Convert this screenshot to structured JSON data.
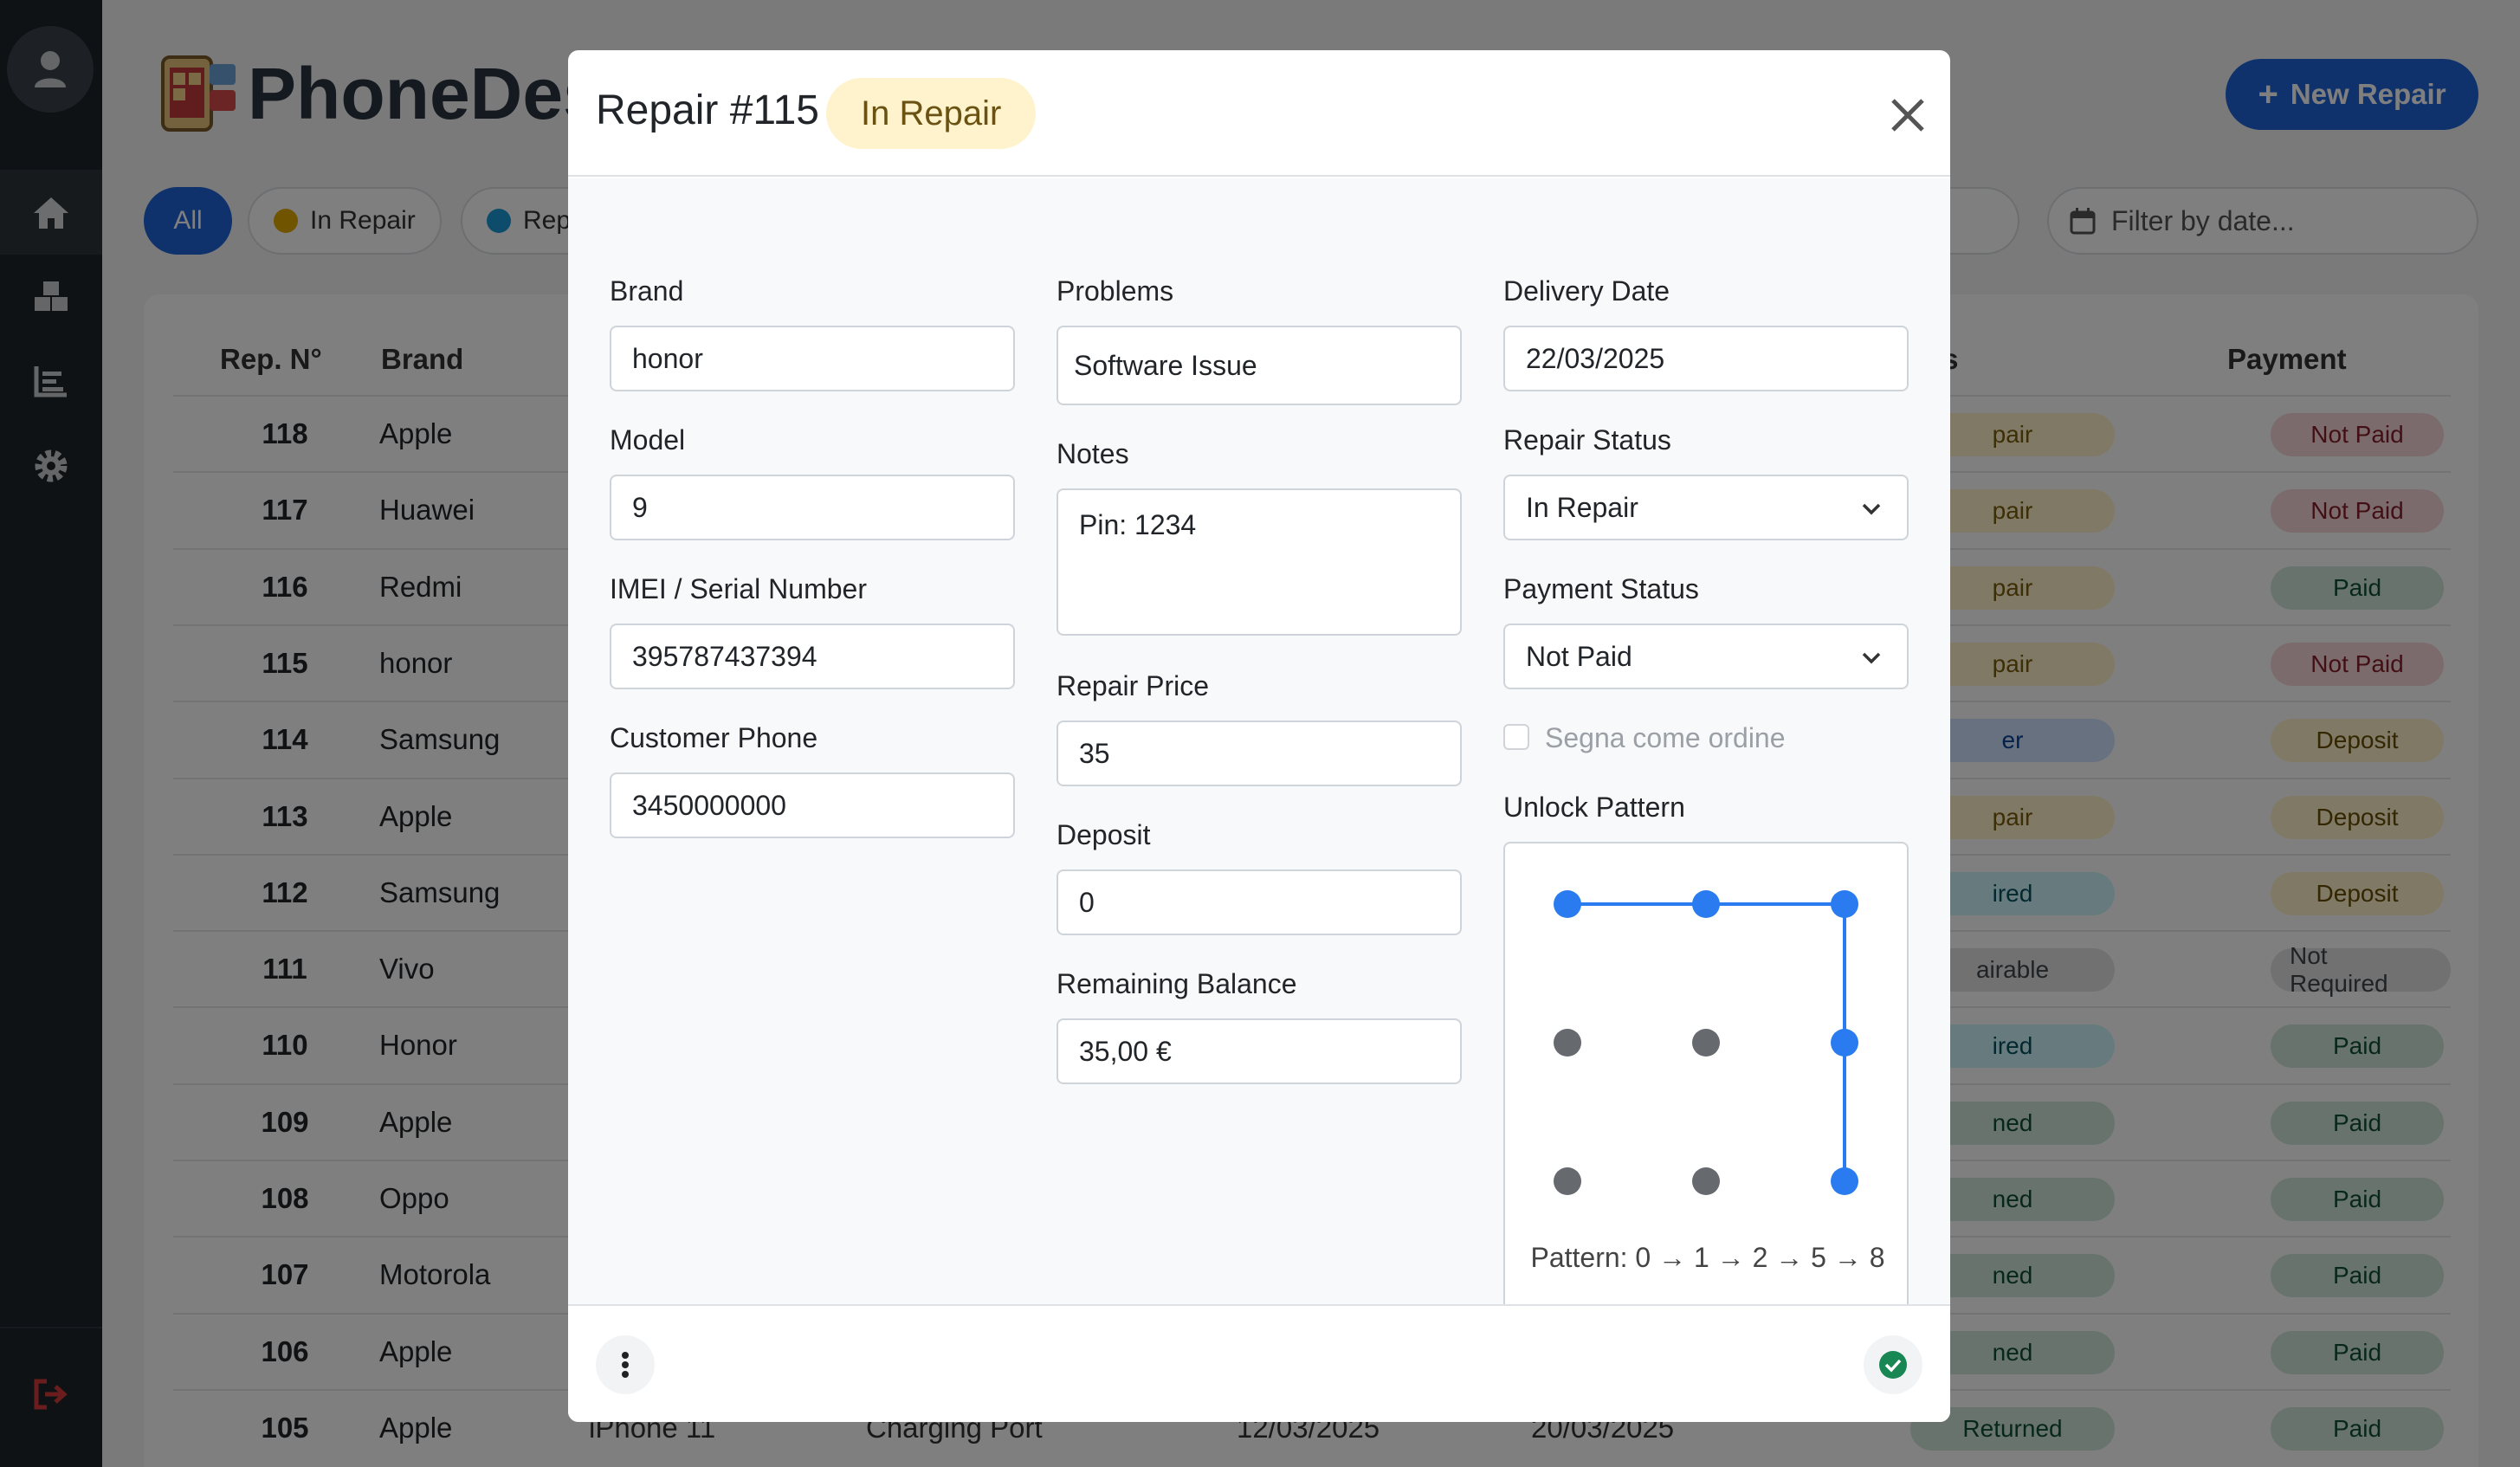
{
  "app": {
    "title": "PhoneDesk",
    "new_repair_label": "New Repair",
    "filter_placeholder": "Filter by date..."
  },
  "filters": {
    "all": "All",
    "in_repair": "In Repair",
    "repaired": "Rep"
  },
  "table": {
    "headers": {
      "num": "Rep. N°",
      "brand": "Brand",
      "status": "tus",
      "payment": "Payment"
    },
    "rows": [
      {
        "num": "118",
        "brand": "Apple",
        "status": "pair",
        "status_color": "#fff3cd",
        "status_text_color": "#7a5c0a",
        "payment": "Not Paid",
        "pay_bg": "#f8d7da",
        "pay_fg": "#842029"
      },
      {
        "num": "117",
        "brand": "Huawei",
        "status": "pair",
        "status_color": "#fff3cd",
        "status_text_color": "#7a5c0a",
        "payment": "Not Paid",
        "pay_bg": "#f8d7da",
        "pay_fg": "#842029"
      },
      {
        "num": "116",
        "brand": "Redmi",
        "status": "pair",
        "status_color": "#fff3cd",
        "status_text_color": "#7a5c0a",
        "payment": "Paid",
        "pay_bg": "#d1e7dd",
        "pay_fg": "#0f5132"
      },
      {
        "num": "115",
        "brand": "honor",
        "status": "pair",
        "status_color": "#fff3cd",
        "status_text_color": "#7a5c0a",
        "payment": "Not Paid",
        "pay_bg": "#f8d7da",
        "pay_fg": "#842029"
      },
      {
        "num": "114",
        "brand": "Samsung",
        "status": "er",
        "status_color": "#cfe2ff",
        "status_text_color": "#084298",
        "payment": "Deposit",
        "pay_bg": "#fff3cd",
        "pay_fg": "#664d03"
      },
      {
        "num": "113",
        "brand": "Apple",
        "status": "pair",
        "status_color": "#fff3cd",
        "status_text_color": "#7a5c0a",
        "payment": "Deposit",
        "pay_bg": "#fff3cd",
        "pay_fg": "#664d03"
      },
      {
        "num": "112",
        "brand": "Samsung",
        "status": "ired",
        "status_color": "#cff4fc",
        "status_text_color": "#055160",
        "payment": "Deposit",
        "pay_bg": "#fff3cd",
        "pay_fg": "#664d03"
      },
      {
        "num": "111",
        "brand": "Vivo",
        "status": "airable",
        "status_color": "#e2e3e5",
        "status_text_color": "#41464b",
        "payment": "Not Required",
        "pay_bg": "#e2e3e5",
        "pay_fg": "#41464b"
      },
      {
        "num": "110",
        "brand": "Honor",
        "status": "ired",
        "status_color": "#cff4fc",
        "status_text_color": "#055160",
        "payment": "Paid",
        "pay_bg": "#d1e7dd",
        "pay_fg": "#0f5132"
      },
      {
        "num": "109",
        "brand": "Apple",
        "status": "ned",
        "status_color": "#d1e7dd",
        "status_text_color": "#0f5132",
        "payment": "Paid",
        "pay_bg": "#d1e7dd",
        "pay_fg": "#0f5132"
      },
      {
        "num": "108",
        "brand": "Oppo",
        "status": "ned",
        "status_color": "#d1e7dd",
        "status_text_color": "#0f5132",
        "payment": "Paid",
        "pay_bg": "#d1e7dd",
        "pay_fg": "#0f5132"
      },
      {
        "num": "107",
        "brand": "Motorola",
        "status": "ned",
        "status_color": "#d1e7dd",
        "status_text_color": "#0f5132",
        "payment": "Paid",
        "pay_bg": "#d1e7dd",
        "pay_fg": "#0f5132"
      },
      {
        "num": "106",
        "brand": "Apple",
        "status": "ned",
        "status_color": "#d1e7dd",
        "status_text_color": "#0f5132",
        "payment": "Paid",
        "pay_bg": "#d1e7dd",
        "pay_fg": "#0f5132"
      },
      {
        "num": "105",
        "brand": "Apple",
        "model": "iPhone 11",
        "problem": "Charging Port",
        "date1": "12/03/2025",
        "date2": "20/03/2025",
        "status": "Returned",
        "status_color": "#d1e7dd",
        "status_text_color": "#0f5132",
        "payment": "Paid",
        "pay_bg": "#d1e7dd",
        "pay_fg": "#0f5132"
      }
    ]
  },
  "modal": {
    "title": "Repair #115",
    "status_badge": "In Repair",
    "brand_label": "Brand",
    "brand_value": "honor",
    "model_label": "Model",
    "model_value": "9",
    "imei_label": "IMEI / Serial Number",
    "imei_value": "395787437394",
    "phone_label": "Customer Phone",
    "phone_value": "3450000000",
    "problems_label": "Problems",
    "problems_value": "Software Issue",
    "notes_label": "Notes",
    "notes_value": "Pin: 1234",
    "price_label": "Repair Price",
    "price_value": "35",
    "deposit_label": "Deposit",
    "deposit_value": "0",
    "balance_label": "Remaining Balance",
    "balance_value": "35,00 €",
    "delivery_label": "Delivery Date",
    "delivery_value": "22/03/2025",
    "repair_status_label": "Repair Status",
    "repair_status_value": "In Repair",
    "payment_status_label": "Payment Status",
    "payment_status_value": "Not Paid",
    "order_checkbox_label": "Segna come ordine",
    "unlock_label": "Unlock Pattern",
    "pattern_text": "Pattern: 0 → 1 → 2 → 5 → 8",
    "pattern_sequence": [
      0,
      1,
      2,
      5,
      8
    ]
  },
  "colors": {
    "accent": "#1e64d8",
    "pattern_active": "#2b7bf0",
    "pattern_inactive": "#666a6e",
    "in_repair_dot": "#e0a800",
    "repaired_dot": "#1a9bd7",
    "save_check": "#198754"
  }
}
